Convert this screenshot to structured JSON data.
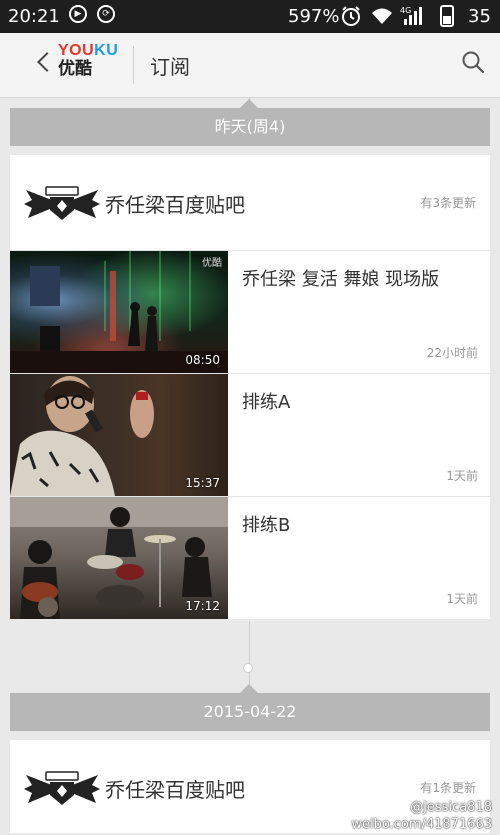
{
  "status_bar": {
    "time": "20:21",
    "battery_percent": "597%",
    "battery_num": "35",
    "network": "4G"
  },
  "header": {
    "logo_en_you": "YOU",
    "logo_en_ku": "KU",
    "logo_cn": "优酷",
    "title": "订阅"
  },
  "sections": [
    {
      "date": "昨天(周4)",
      "channel_name": "乔任梁百度贴吧",
      "update_count": "有3条更新",
      "videos": [
        {
          "title": "乔任梁 复活 舞娘 现场版",
          "duration": "08:50",
          "age": "22小时前",
          "watermark": "优酷"
        },
        {
          "title": "排练A",
          "duration": "15:37",
          "age": "1天前"
        },
        {
          "title": "排练B",
          "duration": "17:12",
          "age": "1天前"
        }
      ]
    },
    {
      "date": "2015-04-22",
      "channel_name": "乔任梁百度贴吧",
      "update_count": "有1条更新"
    }
  ],
  "watermark": {
    "line1": "@Jessica818",
    "line2": "weibo.com/41871663"
  },
  "colors": {
    "date_bar": "#b7b7b7",
    "background": "#e9e9e9",
    "youku_red": "#e6352f",
    "youku_blue": "#1f9be3"
  },
  "icons": [
    "play-circle-icon",
    "sync-icon",
    "alarm-icon",
    "wifi-icon",
    "signal-icon",
    "back-icon",
    "search-icon"
  ]
}
